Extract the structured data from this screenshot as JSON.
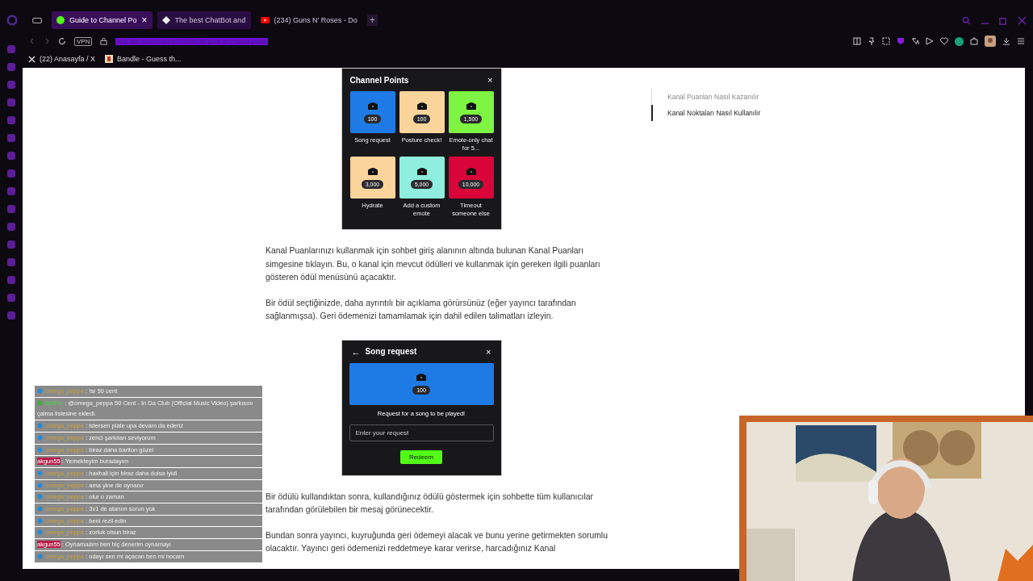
{
  "tab_close": "×",
  "new_tab": "+",
  "tabs": [
    {
      "title": "Guide to Channel Po",
      "selected": true,
      "kind": "help"
    },
    {
      "title": "The best ChatBot and",
      "selected": false,
      "kind": "bot"
    },
    {
      "title": "(234) Guns N' Roses - Do",
      "selected": false,
      "kind": "video"
    }
  ],
  "address": {
    "url": "help.kick.com/en/articles/10708188-guide-to-channel-points",
    "vpn": "VPN"
  },
  "bookmarks": [
    {
      "title": "(22) Anasayfa / X",
      "kind": "x"
    },
    {
      "title": "Bandle - Guess th...",
      "kind": "bandle"
    }
  ],
  "rewards_card": {
    "title": "Channel Points",
    "close": "×",
    "rewards": [
      {
        "cost": "100",
        "label": "Song request",
        "color": "#1e7be6"
      },
      {
        "cost": "100",
        "label": "Posture check!",
        "color": "#fbd49b"
      },
      {
        "cost": "1,500",
        "label": "Emote-only chat for 5...",
        "color": "#7ef542"
      },
      {
        "cost": "3,000",
        "label": "Hydrate",
        "color": "#fbd49b"
      },
      {
        "cost": "5,000",
        "label": "Add a custom emote",
        "color": "#8feedd"
      },
      {
        "cost": "10,000",
        "label": "Timeout someone else",
        "color": "#d9053a"
      }
    ]
  },
  "toc": [
    {
      "label": "Kanal Puanları Nasıl Kazanılır",
      "selected": false
    },
    {
      "label": "Kanal Noktaları Nasıl Kullanılır",
      "selected": true
    }
  ],
  "paragraphs_top": [
    "Kanal Puanlarınızı kullanmak için sohbet giriş alanının altında bulunan Kanal Puanları simgesine tıklayın. Bu, o kanal için mevcut ödülleri ve kullanmak için gereken ilgili puanları gösteren ödül menüsünü açacaktır.",
    "Bir ödül seçtiğinizde, daha ayrıntılı bir açıklama görürsünüz (eğer yayıncı tarafından sağlanmışsa). Geri ödemenizi tamamlamak için dahil edilen talimatları izleyin."
  ],
  "request_card": {
    "back": "←",
    "title": "Song request",
    "close": "×",
    "cost": "100",
    "color": "#1e7be6",
    "description": "Request for a song to be played!",
    "placeholder": "Enter your request",
    "button": "Redeem"
  },
  "paragraphs_bottom": [
    "Bir ödülü kullandıktan sonra, kullandığınız ödülü göstermek için sohbette tüm kullanıcılar tarafından görülebilen bir mesaj görünecektir.",
    "Bundan sonra yayıncı, kuyruğunda geri ödemeyi alacak ve bunu yerine getirmekten sorumlu olacaktır. Yayıncı geri ödemenizi reddetmeye karar verirse, harcadığınız Kanal"
  ],
  "chat": [
    {
      "kind": "user",
      "user": "omega_peppa",
      "text": ": !sr 50 cent"
    },
    {
      "kind": "bot",
      "user": "BotRix",
      "text": ": @omega_peppa 50 Cent - In Da Club (Official Music Video) şarkısını çalma listesine ekledi."
    },
    {
      "kind": "user",
      "user": "omega_peppa",
      "text": ": istersen plate upa devam da ederiz"
    },
    {
      "kind": "user",
      "user": "omega_peppa",
      "text": ": zenci şarkıları seviyorum"
    },
    {
      "kind": "user",
      "user": "omega_peppa",
      "text": ": biraz daha bariton güzel"
    },
    {
      "kind": "plain",
      "user": "akgun55",
      "text": ": Yemekteyim buradayım"
    },
    {
      "kind": "user",
      "user": "omega_peppa",
      "text": ": haxball için biraz daha dolsa iyidi"
    },
    {
      "kind": "user",
      "user": "omega_peppa",
      "text": ": ama yine de oynanır"
    },
    {
      "kind": "user",
      "user": "omega_peppa",
      "text": ": olur o zaman"
    },
    {
      "kind": "user",
      "user": "omega_peppa",
      "text": ": 3v1 de atanım sorun yok"
    },
    {
      "kind": "user",
      "user": "omega_peppa",
      "text": ": beni rezil edin"
    },
    {
      "kind": "user",
      "user": "omega_peppa",
      "text": ": zorluk olsun biraz"
    },
    {
      "kind": "plain",
      "user": "akgun55",
      "text": ": Oynamadım ben hiç denerim oynamayı"
    },
    {
      "kind": "user",
      "user": "omega_peppa",
      "text": ": odayı sen mi açacan ben mi hocam"
    }
  ]
}
